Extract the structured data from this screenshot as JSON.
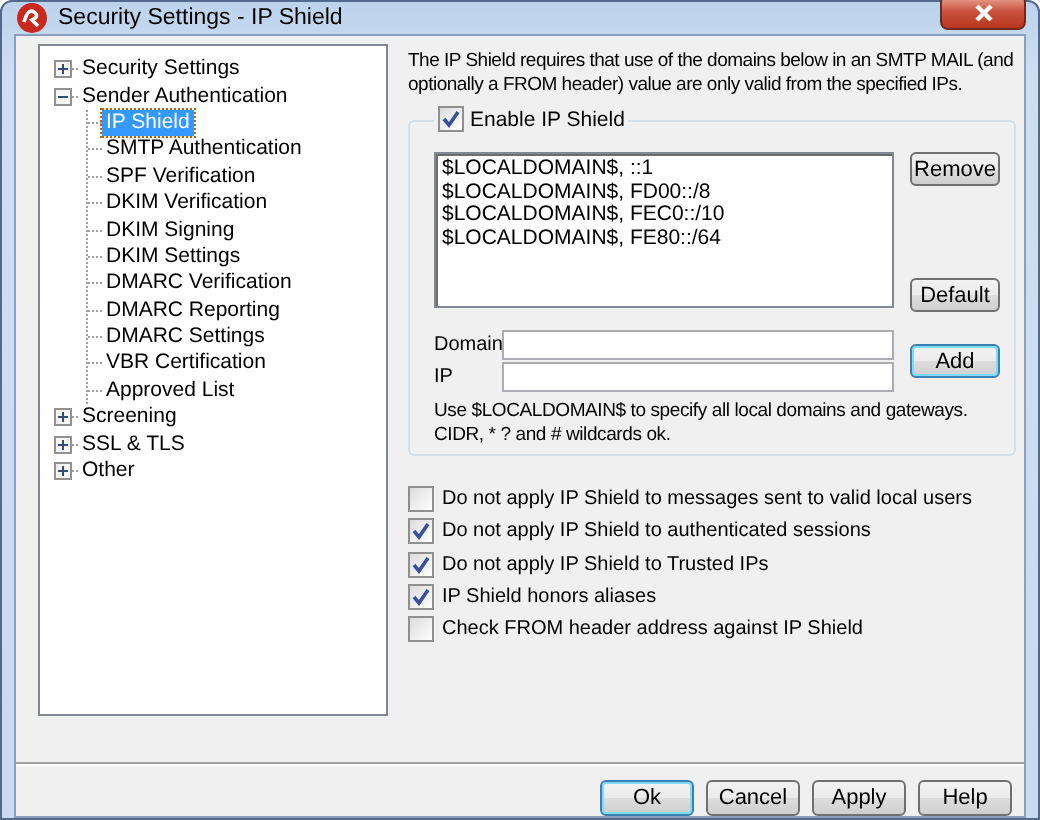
{
  "window": {
    "title": "Security Settings - IP Shield"
  },
  "tree": [
    {
      "label": "Security Settings",
      "expanded": false,
      "selected": false
    },
    {
      "label": "Sender Authentication",
      "expanded": true,
      "selected": false,
      "children": [
        {
          "label": "IP Shield",
          "selected": true
        },
        {
          "label": "SMTP Authentication",
          "selected": false
        },
        {
          "label": "SPF Verification",
          "selected": false
        },
        {
          "label": "DKIM Verification",
          "selected": false
        },
        {
          "label": "DKIM Signing",
          "selected": false
        },
        {
          "label": "DKIM Settings",
          "selected": false
        },
        {
          "label": "DMARC Verification",
          "selected": false
        },
        {
          "label": "DMARC Reporting",
          "selected": false
        },
        {
          "label": "DMARC Settings",
          "selected": false
        },
        {
          "label": "VBR Certification",
          "selected": false
        },
        {
          "label": "Approved List",
          "selected": false
        }
      ]
    },
    {
      "label": "Screening",
      "expanded": false,
      "selected": false
    },
    {
      "label": "SSL & TLS",
      "expanded": false,
      "selected": false
    },
    {
      "label": "Other",
      "expanded": false,
      "selected": false
    }
  ],
  "description": "The IP Shield requires that use of the domains below in an SMTP MAIL (and\noptionally a FROM header) value are only valid from the specified IPs.",
  "enable_ip_shield": {
    "label": "Enable IP Shield",
    "checked": true
  },
  "entries": [
    "$LOCALDOMAIN$, ::1",
    "$LOCALDOMAIN$, FD00::/8",
    "$LOCALDOMAIN$, FEC0::/10",
    "$LOCALDOMAIN$, FE80::/64"
  ],
  "remove_button": {
    "label": "Remove",
    "default": false
  },
  "default_button": {
    "label": "Default",
    "default": false
  },
  "domain_field": {
    "label": "Domain"
  },
  "ip_field": {
    "label": "IP"
  },
  "add_button": {
    "label": "Add",
    "default": true
  },
  "hint": "Use $LOCALDOMAIN$ to specify all local domains and gateways.\nCIDR, * ? and # wildcards ok.",
  "options": [
    {
      "label": "Do not apply IP Shield to messages sent to valid local users",
      "checked": false
    },
    {
      "label": "Do not apply IP Shield to authenticated sessions",
      "checked": true
    },
    {
      "label": "Do not apply IP Shield to Trusted IPs",
      "checked": true
    },
    {
      "label": "IP Shield honors aliases",
      "checked": true
    },
    {
      "label": "Check FROM header address against IP Shield",
      "checked": false
    }
  ],
  "buttons": [
    {
      "label": "Ok",
      "default": true
    },
    {
      "label": "Cancel",
      "default": false
    },
    {
      "label": "Apply",
      "default": false
    },
    {
      "label": "Help",
      "default": false
    }
  ]
}
